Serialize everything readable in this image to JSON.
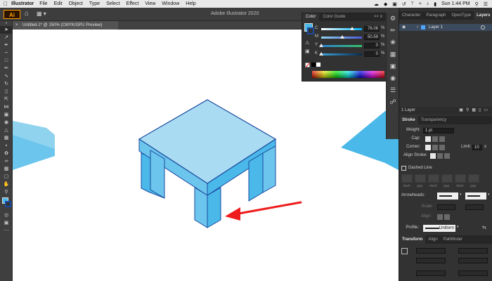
{
  "menubar": {
    "app_name": "Illustrator",
    "items": [
      "File",
      "Edit",
      "Object",
      "Type",
      "Select",
      "Effect",
      "View",
      "Window",
      "Help"
    ],
    "clock": "Sun 1:44 PM"
  },
  "appbar": {
    "logo": "Ai",
    "title": "Adobe Illustrator 2020"
  },
  "document_tab": {
    "label": "Untitled-1* @ 150% (CMYK/GPU Preview)",
    "close": "×"
  },
  "color_panel": {
    "tabs": [
      "Color",
      "Color Guide"
    ],
    "more": ">>  ≡",
    "channels": [
      {
        "label": "C",
        "value": "76.08",
        "unit": "%"
      },
      {
        "label": "M",
        "value": "50.59",
        "unit": "%"
      },
      {
        "label": "Y",
        "value": "0",
        "unit": "%"
      },
      {
        "label": "K",
        "value": "0",
        "unit": "%"
      }
    ],
    "colors": {
      "fill": "#4ab8e8",
      "stroke": "#1a4aa0"
    }
  },
  "right_panel": {
    "tabs": [
      "Character",
      "Paragraph",
      "OpenType",
      "Layers"
    ],
    "layer_name": "Layer 1",
    "layer_count": "1 Layer",
    "stroke_tabs": [
      "Stroke",
      "Transparency"
    ],
    "weight_label": "Weight:",
    "weight_value": "1 pt",
    "cap_label": "Cap:",
    "corner_label": "Corner:",
    "limit_label": "Limit:",
    "limit_value": "10",
    "limit_unit": "x",
    "align_label": "Align Stroke:",
    "dashed_label": "Dashed Line",
    "dash_labels": [
      "dash",
      "gap",
      "dash",
      "gap",
      "dash",
      "gap"
    ],
    "arrowheads_label": "Arrowheads:",
    "scale_label": "Scale:",
    "align2_label": "Align:",
    "profile_label": "Profile:",
    "profile_value": "Uniform",
    "transform_tabs": [
      "Transform",
      "Align",
      "Pathfinder"
    ]
  },
  "toolbar": {
    "tools": [
      "select-tool",
      "direct-select-tool",
      "pen-tool",
      "curvature-tool",
      "rectangle-tool",
      "paintbrush-tool",
      "pencil-tool",
      "rotate-tool",
      "scale-tool",
      "eraser-tool",
      "width-tool",
      "free-transform-tool",
      "shape-builder-tool",
      "perspective-tool",
      "mesh-tool",
      "gradient-tool",
      "eyedropper-tool",
      "blend-tool",
      "symbol-sprayer-tool",
      "column-graph-tool",
      "artboard-tool",
      "slice-tool",
      "hand-tool",
      "zoom-tool"
    ]
  }
}
